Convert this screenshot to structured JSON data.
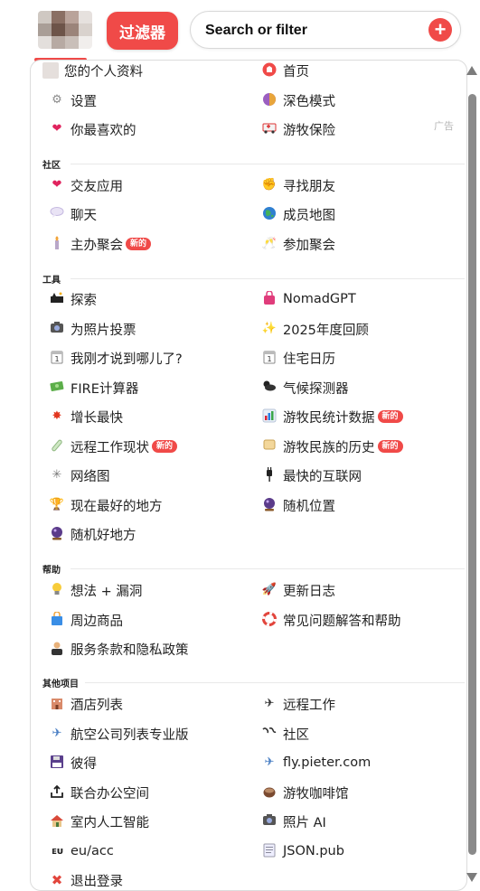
{
  "header": {
    "filter_label": "过滤器",
    "search_placeholder": "Search or filter",
    "add_icon": "plus-icon"
  },
  "menu": {
    "ad_label": "广告",
    "top": {
      "profile": "您的个人资料",
      "home": "首页",
      "settings": "设置",
      "dark_mode": "深色模式",
      "favorites": "你最喜欢的",
      "insurance": "游牧保险"
    },
    "community": {
      "heading": "社区",
      "dating": "交友应用",
      "find_friends": "寻找朋友",
      "chat": "聊天",
      "members_map": "成员地图",
      "host_meetup": "主办聚会",
      "join_meetup": "参加聚会"
    },
    "tools": {
      "heading": "工具",
      "explore": "探索",
      "nomadgpt": "NomadGPT",
      "photo_vote": "为照片投票",
      "year_review": "2025年度回顾",
      "where_was_i": "我刚才说到哪儿了?",
      "stay_calendar": "住宅日历",
      "fire": "FIRE计算器",
      "climate": "气候探测器",
      "fastest_growing": "增长最快",
      "nomad_stats": "游牧民统计数据",
      "remote_work_state": "远程工作现状",
      "nomad_history": "游牧民族的历史",
      "network": "网络图",
      "fastest_internet": "最快的互联网",
      "best_now": "现在最好的地方",
      "random_location": "随机位置",
      "random_good": "随机好地方"
    },
    "help": {
      "heading": "帮助",
      "ideas_bugs": "想法 + 漏洞",
      "changelog": "更新日志",
      "merch": "周边商品",
      "faq": "常见问题解答和帮助",
      "terms": "服务条款和隐私政策"
    },
    "other": {
      "heading": "其他项目",
      "hotels": "酒店列表",
      "remote_work": "远程工作",
      "airlines": "航空公司列表专业版",
      "community": "社区",
      "bide": "彼得",
      "fly": "fly.pieter.com",
      "coworking": "联合办公空间",
      "cafes": "游牧咖啡馆",
      "interior_ai": "室内人工智能",
      "photo_ai": "照片 AI",
      "eu_acc": "eu/acc",
      "json_pub": "JSON.pub",
      "logout": "退出登录"
    },
    "new_badge": "新的"
  },
  "colors": {
    "accent": "#f04a48",
    "border": "#dcdcdc",
    "scrollbar": "#8a8a8a"
  }
}
